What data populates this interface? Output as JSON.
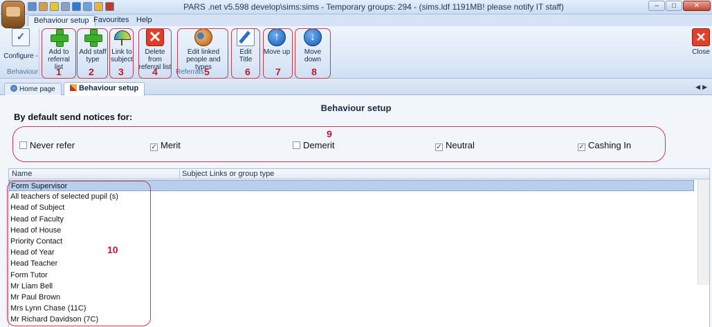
{
  "titlebar": {
    "title": "PARS .net v5.598  develop\\sims:sims - Temporary groups: 294 - (sims.ldf 1191MB! please notify IT staff)",
    "window_buttons": [
      "–",
      "□",
      "✕"
    ]
  },
  "ribbon_tabs": [
    "Behaviour setup",
    "Favourites",
    "Help"
  ],
  "ribbon": {
    "configure_label": "Configure -",
    "behaviour_group_label": "Behaviour",
    "referrals_group_label": "Referrals",
    "buttons": {
      "add_referral": "Add to referral list",
      "add_staff": "Add staff type",
      "link_subject": "Link to subject",
      "delete_referral": "Delete from referral list",
      "edit_linked": "Edit linked people and types",
      "edit_title": "Edit Title",
      "move_up": "Move up",
      "move_down": "Move down",
      "close": "Close"
    },
    "annotation_numbers": [
      "1",
      "2",
      "3",
      "4",
      "5",
      "6",
      "7",
      "8"
    ]
  },
  "doc_tabs": [
    "Home page",
    "Behaviour setup"
  ],
  "content": {
    "page_title": "Behaviour setup",
    "section_header": "By default send notices for:",
    "annotation_9": "9",
    "annotation_10": "10",
    "checkboxes": [
      {
        "label": "Never refer",
        "checked": false
      },
      {
        "label": "Merit",
        "checked": true
      },
      {
        "label": "Demerit",
        "checked": false
      },
      {
        "label": "Neutral",
        "checked": true
      },
      {
        "label": "Cashing In",
        "checked": true
      }
    ],
    "grid": {
      "columns": [
        "Name",
        "Subject Links or group type"
      ],
      "rows": [
        "Form Supervisor",
        "All teachers of selected pupil (s)",
        "Head of Subject",
        "Head of Faculty",
        "Head of House",
        "Priority Contact",
        "Head of Year",
        "Head Teacher",
        "Form Tutor",
        "Mr Liam Bell",
        "Mr Paul Brown",
        "Mrs Lynn Chase (11C)",
        "Mr Richard Davidson (7C)"
      ],
      "selected_row": 0
    }
  }
}
